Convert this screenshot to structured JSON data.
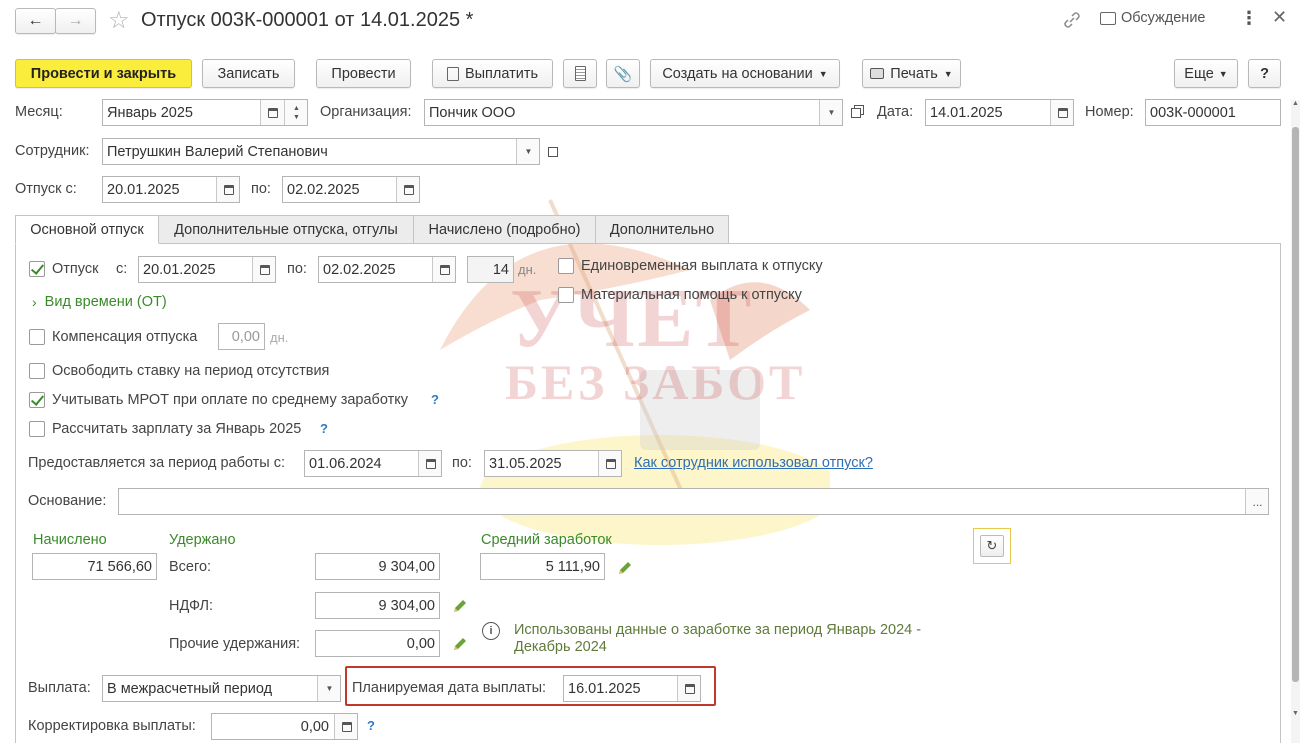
{
  "title": "Отпуск 003К-000001 от 14.01.2025 *",
  "discussion": "Обсуждение",
  "toolbar": {
    "post_close": "Провести и закрыть",
    "save": "Записать",
    "post": "Провести",
    "pay": "Выплатить",
    "create_based": "Создать на основании",
    "print": "Печать",
    "more": "Еще",
    "help": "?"
  },
  "header": {
    "month_label": "Месяц:",
    "month_value": "Январь 2025",
    "org_label": "Организация:",
    "org_value": "Пончик ООО",
    "date_label": "Дата:",
    "date_value": "14.01.2025",
    "number_label": "Номер:",
    "number_value": "003К-000001",
    "employee_label": "Сотрудник:",
    "employee_value": "Петрушкин Валерий Степанович",
    "vac_from_label": "Отпуск с:",
    "vac_from_value": "20.01.2025",
    "vac_to_label": "по:",
    "vac_to_value": "02.02.2025"
  },
  "tabs": [
    {
      "label": "Основной отпуск"
    },
    {
      "label": "Дополнительные отпуска, отгулы"
    },
    {
      "label": "Начислено (подробно)"
    },
    {
      "label": "Дополнительно"
    }
  ],
  "main": {
    "vacation_label": "Отпуск",
    "from_label": "с:",
    "from_value": "20.01.2025",
    "to_label": "по:",
    "to_value": "02.02.2025",
    "days_value": "14",
    "days_unit": "дн.",
    "lump_sum": "Единовременная выплата к отпуску",
    "material_aid": "Материальная помощь к отпуску",
    "time_type": "Вид времени (ОТ)",
    "compensation": "Компенсация отпуска",
    "comp_value": "0,00",
    "comp_unit": "дн.",
    "free_rate": "Освободить ставку на период отсутствия",
    "mrot": "Учитывать МРОТ при оплате по среднему заработку",
    "calc_salary": "Рассчитать зарплату за Январь 2025",
    "period_label": "Предоставляется за период работы с:",
    "period_from": "01.06.2024",
    "period_to_label": "по:",
    "period_to": "31.05.2025",
    "usage_link": "Как сотрудник использовал отпуск?",
    "basis_label": "Основание:",
    "basis_value": "",
    "basis_btn": "..."
  },
  "totals": {
    "accrued_label": "Начислено",
    "accrued_value": "71 566,60",
    "withheld_label": "Удержано",
    "total_label": "Всего:",
    "total_value": "9 304,00",
    "ndfl_label": "НДФЛ:",
    "ndfl_value": "9 304,00",
    "other_label": "Прочие удержания:",
    "other_value": "0,00",
    "avg_label": "Средний заработок",
    "avg_value": "5 111,90",
    "info_text": "Использованы данные о заработке за период Январь 2024 - Декабрь 2024"
  },
  "payment": {
    "label": "Выплата:",
    "value": "В межрасчетный период",
    "planned_label": "Планируемая дата выплаты:",
    "planned_value": "16.01.2025",
    "correction_label": "Корректировка выплаты:",
    "correction_value": "0,00"
  },
  "watermark": {
    "line1": "УЧЕТ",
    "line2": "БЕЗ ЗАБОТ"
  },
  "colors": {
    "primary": "#fbed3c",
    "green": "#3a8a2a",
    "link": "#2f6fb7",
    "highlight": "#c0392b"
  }
}
